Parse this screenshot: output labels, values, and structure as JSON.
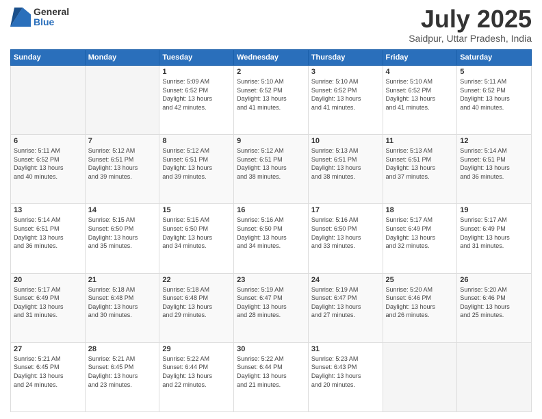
{
  "header": {
    "logo_general": "General",
    "logo_blue": "Blue",
    "month": "July 2025",
    "location": "Saidpur, Uttar Pradesh, India"
  },
  "days_of_week": [
    "Sunday",
    "Monday",
    "Tuesday",
    "Wednesday",
    "Thursday",
    "Friday",
    "Saturday"
  ],
  "weeks": [
    [
      {
        "day": "",
        "info": ""
      },
      {
        "day": "",
        "info": ""
      },
      {
        "day": "1",
        "info": "Sunrise: 5:09 AM\nSunset: 6:52 PM\nDaylight: 13 hours\nand 42 minutes."
      },
      {
        "day": "2",
        "info": "Sunrise: 5:10 AM\nSunset: 6:52 PM\nDaylight: 13 hours\nand 41 minutes."
      },
      {
        "day": "3",
        "info": "Sunrise: 5:10 AM\nSunset: 6:52 PM\nDaylight: 13 hours\nand 41 minutes."
      },
      {
        "day": "4",
        "info": "Sunrise: 5:10 AM\nSunset: 6:52 PM\nDaylight: 13 hours\nand 41 minutes."
      },
      {
        "day": "5",
        "info": "Sunrise: 5:11 AM\nSunset: 6:52 PM\nDaylight: 13 hours\nand 40 minutes."
      }
    ],
    [
      {
        "day": "6",
        "info": "Sunrise: 5:11 AM\nSunset: 6:52 PM\nDaylight: 13 hours\nand 40 minutes."
      },
      {
        "day": "7",
        "info": "Sunrise: 5:12 AM\nSunset: 6:51 PM\nDaylight: 13 hours\nand 39 minutes."
      },
      {
        "day": "8",
        "info": "Sunrise: 5:12 AM\nSunset: 6:51 PM\nDaylight: 13 hours\nand 39 minutes."
      },
      {
        "day": "9",
        "info": "Sunrise: 5:12 AM\nSunset: 6:51 PM\nDaylight: 13 hours\nand 38 minutes."
      },
      {
        "day": "10",
        "info": "Sunrise: 5:13 AM\nSunset: 6:51 PM\nDaylight: 13 hours\nand 38 minutes."
      },
      {
        "day": "11",
        "info": "Sunrise: 5:13 AM\nSunset: 6:51 PM\nDaylight: 13 hours\nand 37 minutes."
      },
      {
        "day": "12",
        "info": "Sunrise: 5:14 AM\nSunset: 6:51 PM\nDaylight: 13 hours\nand 36 minutes."
      }
    ],
    [
      {
        "day": "13",
        "info": "Sunrise: 5:14 AM\nSunset: 6:51 PM\nDaylight: 13 hours\nand 36 minutes."
      },
      {
        "day": "14",
        "info": "Sunrise: 5:15 AM\nSunset: 6:50 PM\nDaylight: 13 hours\nand 35 minutes."
      },
      {
        "day": "15",
        "info": "Sunrise: 5:15 AM\nSunset: 6:50 PM\nDaylight: 13 hours\nand 34 minutes."
      },
      {
        "day": "16",
        "info": "Sunrise: 5:16 AM\nSunset: 6:50 PM\nDaylight: 13 hours\nand 34 minutes."
      },
      {
        "day": "17",
        "info": "Sunrise: 5:16 AM\nSunset: 6:50 PM\nDaylight: 13 hours\nand 33 minutes."
      },
      {
        "day": "18",
        "info": "Sunrise: 5:17 AM\nSunset: 6:49 PM\nDaylight: 13 hours\nand 32 minutes."
      },
      {
        "day": "19",
        "info": "Sunrise: 5:17 AM\nSunset: 6:49 PM\nDaylight: 13 hours\nand 31 minutes."
      }
    ],
    [
      {
        "day": "20",
        "info": "Sunrise: 5:17 AM\nSunset: 6:49 PM\nDaylight: 13 hours\nand 31 minutes."
      },
      {
        "day": "21",
        "info": "Sunrise: 5:18 AM\nSunset: 6:48 PM\nDaylight: 13 hours\nand 30 minutes."
      },
      {
        "day": "22",
        "info": "Sunrise: 5:18 AM\nSunset: 6:48 PM\nDaylight: 13 hours\nand 29 minutes."
      },
      {
        "day": "23",
        "info": "Sunrise: 5:19 AM\nSunset: 6:47 PM\nDaylight: 13 hours\nand 28 minutes."
      },
      {
        "day": "24",
        "info": "Sunrise: 5:19 AM\nSunset: 6:47 PM\nDaylight: 13 hours\nand 27 minutes."
      },
      {
        "day": "25",
        "info": "Sunrise: 5:20 AM\nSunset: 6:46 PM\nDaylight: 13 hours\nand 26 minutes."
      },
      {
        "day": "26",
        "info": "Sunrise: 5:20 AM\nSunset: 6:46 PM\nDaylight: 13 hours\nand 25 minutes."
      }
    ],
    [
      {
        "day": "27",
        "info": "Sunrise: 5:21 AM\nSunset: 6:45 PM\nDaylight: 13 hours\nand 24 minutes."
      },
      {
        "day": "28",
        "info": "Sunrise: 5:21 AM\nSunset: 6:45 PM\nDaylight: 13 hours\nand 23 minutes."
      },
      {
        "day": "29",
        "info": "Sunrise: 5:22 AM\nSunset: 6:44 PM\nDaylight: 13 hours\nand 22 minutes."
      },
      {
        "day": "30",
        "info": "Sunrise: 5:22 AM\nSunset: 6:44 PM\nDaylight: 13 hours\nand 21 minutes."
      },
      {
        "day": "31",
        "info": "Sunrise: 5:23 AM\nSunset: 6:43 PM\nDaylight: 13 hours\nand 20 minutes."
      },
      {
        "day": "",
        "info": ""
      },
      {
        "day": "",
        "info": ""
      }
    ]
  ]
}
